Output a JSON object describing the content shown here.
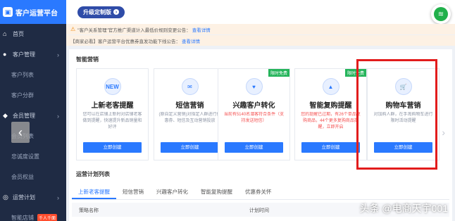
{
  "app": {
    "title": "客户运营平台"
  },
  "sidebar": {
    "items": [
      {
        "label": "首页",
        "icon": "home-icon"
      },
      {
        "label": "客户管理",
        "icon": "user-icon"
      },
      {
        "label": "客户列表"
      },
      {
        "label": "客户分群"
      },
      {
        "label": "会员管理",
        "icon": "vip-icon"
      },
      {
        "label": "会员列表"
      },
      {
        "label": "忠诚度设置"
      },
      {
        "label": "会员权益"
      },
      {
        "label": "运营计划",
        "icon": "plan-icon"
      },
      {
        "label": "智能店铺",
        "tag": "千人千面"
      }
    ]
  },
  "topbar": {
    "upgrade_label": "升级定制版"
  },
  "notices": [
    {
      "text": "\"客户关系管理\"官方推广渠道计入最低价规则变更公告：",
      "link": "查看详情"
    },
    {
      "text": "【商家必看】客户运营平台优惠券直发功能下线公告：",
      "link": "查看详情"
    }
  ],
  "smart_marketing": {
    "title": "智能营销",
    "cards": [
      {
        "icon": "new-badge-icon",
        "icon_text": "NEW",
        "title": "上新老客提醒",
        "desc": "您可以在店铺上新时对店铺老客做到提醒，快速提升新品销量和好评",
        "desc_red": false,
        "ribbon": "",
        "button": "立即创建"
      },
      {
        "icon": "message-icon",
        "icon_text": "✉",
        "title": "短信营销",
        "desc": "(原自定义营销)对指定人群进行优惠券、短信及互动营销投放",
        "desc_red": false,
        "ribbon": "",
        "button": "立即创建"
      },
      {
        "icon": "heart-icon",
        "icon_text": "♥",
        "title": "兴趣客户转化",
        "desc": "当前有5140名潜客符合条件（支持发送短信）",
        "desc_red": true,
        "ribbon": "限时免费",
        "button": "立即创建"
      },
      {
        "icon": "bell-icon",
        "icon_text": "▲",
        "title": "智能复购提醒",
        "desc": "您的提醒已过期，有26个单品复购商品，44个更多复购商品提醒，立即开启",
        "desc_red": true,
        "ribbon": "限时免费",
        "button": "立即创建"
      },
      {
        "icon": "cart-icon",
        "icon_text": "🛒",
        "title": "购物车营销",
        "desc": "对加购人群，在手淘购物车进行限时活动提醒",
        "desc_red": false,
        "ribbon": "",
        "button": "立即创建"
      }
    ]
  },
  "plan_list": {
    "title": "运营计划列表",
    "tabs": [
      "上新老客提醒",
      "短信营销",
      "兴趣客户转化",
      "智能复购提醒",
      "优惠券关怀"
    ],
    "columns": [
      "策略名称",
      "计划时间"
    ]
  },
  "watermark": "头条 @电商天宇001"
}
